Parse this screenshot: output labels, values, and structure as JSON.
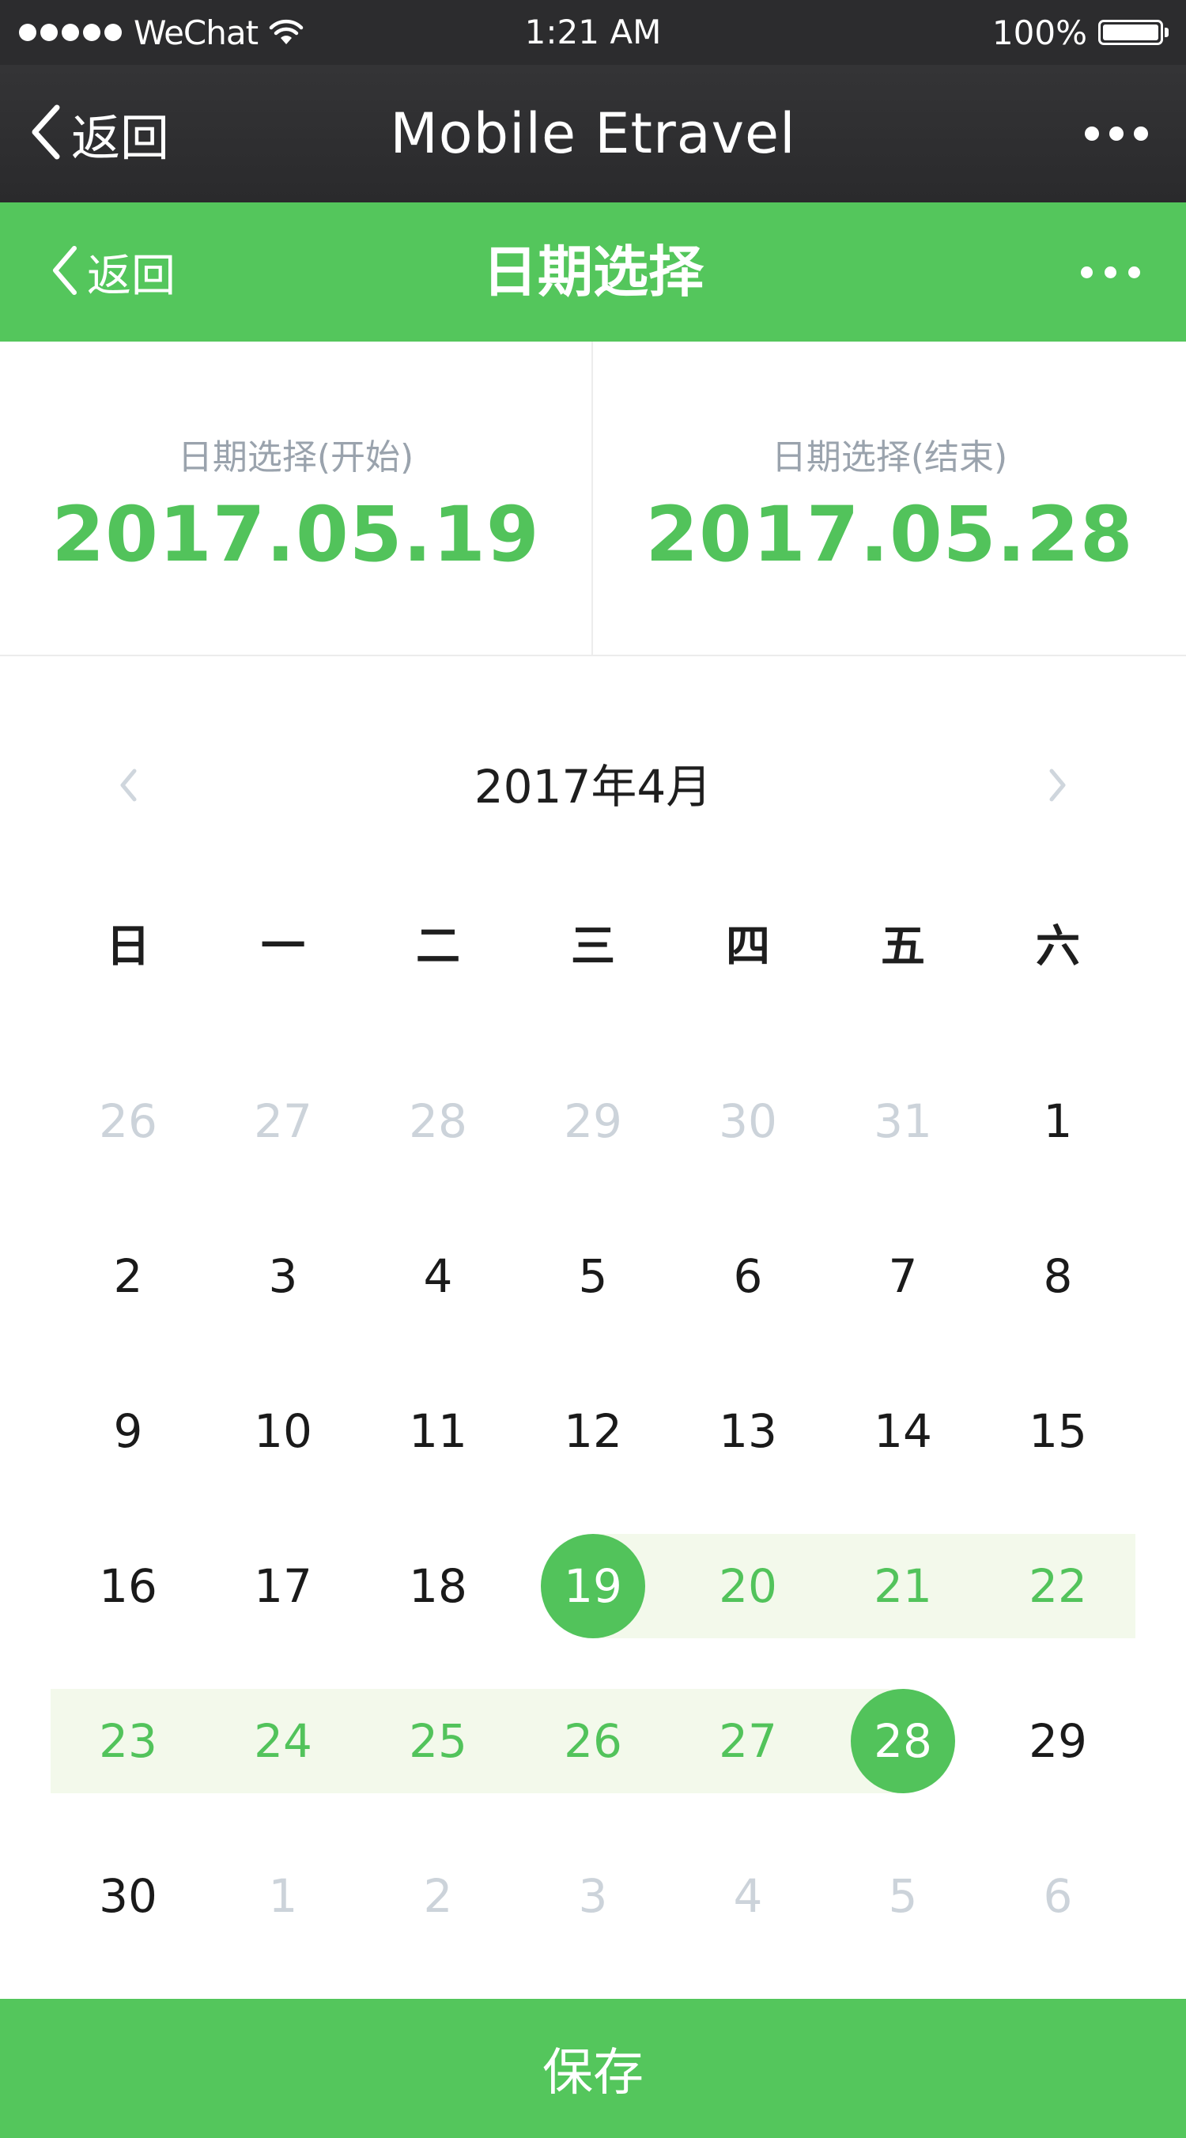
{
  "status_bar": {
    "carrier": "WeChat",
    "time": "1:21 AM",
    "battery": "100%",
    "signal_icon": "signal-dots-icon",
    "wifi_icon": "wifi-icon",
    "battery_icon": "battery-icon"
  },
  "wechat_nav": {
    "back_label": "返回",
    "title": "Mobile Etravel",
    "more_icon": "more-dots-icon"
  },
  "page_header": {
    "back_label": "返回",
    "title": "日期选择",
    "more_icon": "more-dots-icon"
  },
  "range": {
    "start_label": "日期选择(开始)",
    "start_value": "2017.05.19",
    "end_label": "日期选择(结束)",
    "end_value": "2017.05.28"
  },
  "calendar": {
    "month_title": "2017年4月",
    "prev_icon": "chevron-left-icon",
    "next_icon": "chevron-right-icon",
    "weekdays": [
      "日",
      "一",
      "二",
      "三",
      "四",
      "五",
      "六"
    ],
    "days": [
      {
        "label": "26",
        "state": "muted"
      },
      {
        "label": "27",
        "state": "muted"
      },
      {
        "label": "28",
        "state": "muted"
      },
      {
        "label": "29",
        "state": "muted"
      },
      {
        "label": "30",
        "state": "muted"
      },
      {
        "label": "31",
        "state": "muted"
      },
      {
        "label": "1",
        "state": "normal"
      },
      {
        "label": "2",
        "state": "normal"
      },
      {
        "label": "3",
        "state": "normal"
      },
      {
        "label": "4",
        "state": "normal"
      },
      {
        "label": "5",
        "state": "normal"
      },
      {
        "label": "6",
        "state": "normal"
      },
      {
        "label": "7",
        "state": "normal"
      },
      {
        "label": "8",
        "state": "normal"
      },
      {
        "label": "9",
        "state": "normal"
      },
      {
        "label": "10",
        "state": "normal"
      },
      {
        "label": "11",
        "state": "normal"
      },
      {
        "label": "12",
        "state": "normal"
      },
      {
        "label": "13",
        "state": "normal"
      },
      {
        "label": "14",
        "state": "normal"
      },
      {
        "label": "15",
        "state": "normal"
      },
      {
        "label": "16",
        "state": "normal"
      },
      {
        "label": "17",
        "state": "normal"
      },
      {
        "label": "18",
        "state": "normal"
      },
      {
        "label": "19",
        "state": "range-start"
      },
      {
        "label": "20",
        "state": "in-range"
      },
      {
        "label": "21",
        "state": "in-range"
      },
      {
        "label": "22",
        "state": "in-range"
      },
      {
        "label": "23",
        "state": "in-range"
      },
      {
        "label": "24",
        "state": "in-range"
      },
      {
        "label": "25",
        "state": "in-range"
      },
      {
        "label": "26",
        "state": "in-range"
      },
      {
        "label": "27",
        "state": "in-range"
      },
      {
        "label": "28",
        "state": "range-end"
      },
      {
        "label": "29",
        "state": "normal"
      },
      {
        "label": "30",
        "state": "normal"
      },
      {
        "label": "1",
        "state": "muted"
      },
      {
        "label": "2",
        "state": "muted"
      },
      {
        "label": "3",
        "state": "muted"
      },
      {
        "label": "4",
        "state": "muted"
      },
      {
        "label": "5",
        "state": "muted"
      },
      {
        "label": "6",
        "state": "muted"
      }
    ]
  },
  "save_label": "保存",
  "colors": {
    "accent": "#54c65c",
    "range_band": "#f3f9eb",
    "nav_dark": "#2c2c2e",
    "muted_text": "#ccd3da",
    "label_gray": "#9aa3ad"
  }
}
